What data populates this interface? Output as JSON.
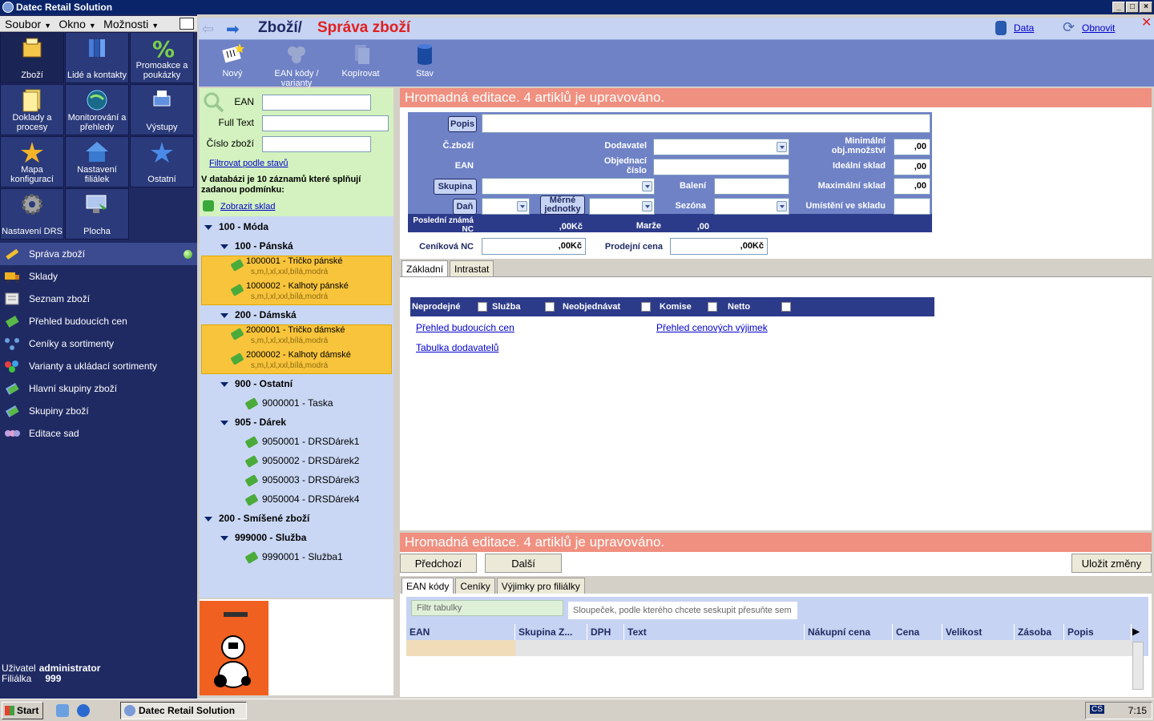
{
  "window": {
    "title": "Datec Retail Solution"
  },
  "menu": {
    "items": [
      "Soubor",
      "Okno",
      "Možnosti"
    ]
  },
  "tiles": [
    {
      "label": "Zboží",
      "icon": "box-icon"
    },
    {
      "label": "Lidé a kontakty",
      "icon": "books-icon"
    },
    {
      "label": "Promoakce a poukázky",
      "icon": "percent-icon"
    },
    {
      "label": "Doklady a procesy",
      "icon": "documents-icon"
    },
    {
      "label": "Monitorování a přehledy",
      "icon": "globe-icon"
    },
    {
      "label": "Výstupy",
      "icon": "printer-icon"
    },
    {
      "label": "Mapa konfigurací",
      "icon": "star-burst-icon"
    },
    {
      "label": "Nastavení filiálek",
      "icon": "house-icon"
    },
    {
      "label": "Ostatní",
      "icon": "star-icon"
    },
    {
      "label": "Nastavení DRS",
      "icon": "gear-icon"
    },
    {
      "label": "Plocha",
      "icon": "desktop-icon"
    }
  ],
  "nav": [
    {
      "label": "Správa zboží",
      "icon": "wrench-icon"
    },
    {
      "label": "Sklady",
      "icon": "truck-icon"
    },
    {
      "label": "Seznam zboží",
      "icon": "list-icon"
    },
    {
      "label": "Přehled budoucích cen",
      "icon": "pricetag-icon"
    },
    {
      "label": "Ceníky a sortimenty",
      "icon": "network-icon"
    },
    {
      "label": "Varianty a ukládací sortimenty",
      "icon": "balls-icon"
    },
    {
      "label": "Hlavní skupiny zboží",
      "icon": "tags-icon"
    },
    {
      "label": "Skupiny zboží",
      "icon": "tags-icon"
    },
    {
      "label": "Editace sad",
      "icon": "spheres-icon"
    }
  ],
  "user": {
    "label_user": "Uživatel",
    "user": "administrator",
    "label_branch": "Filiálka",
    "branch": "999"
  },
  "header": {
    "crumb": "Zboží/",
    "title": "Správa zboží",
    "data": "Data",
    "refresh": "Obnovit"
  },
  "toolbar": {
    "new": "Nový",
    "ean": "EAN kódy / varianty",
    "copy": "Kopírovat",
    "state": "Stav"
  },
  "search": {
    "ean": "EAN",
    "fulltext": "Full Text",
    "number": "Číslo zboží",
    "filter_link": "Filtrovat podle stavů",
    "result": "V databázi je 10 záznamů které splňují zadanou podmínku:",
    "show_stock": "Zobrazit sklad"
  },
  "tree": {
    "g1": "100 - Móda",
    "g1a": "100 - Pánská",
    "i1": "1000001 - Tričko pánské",
    "i1s": "s,m,l,xl,xxl,bílá,modrá",
    "i2": "1000002 - Kalhoty pánské",
    "i2s": "s,m,l,xl,xxl,bílá,modrá",
    "g1b": "200 - Dámská",
    "i3": "2000001 - Tričko dámské",
    "i3s": "s,m,l,xl,xxl,bílá,modrá",
    "i4": "2000002 - Kalhoty dámské",
    "i4s": "s,m,l,xl,xxl,bílá,modrá",
    "g2": "900 - Ostatní",
    "i5": "9000001 - Taska",
    "g3": "905 - Dárek",
    "i6": "9050001 - DRSDárek1",
    "i7": "9050002 - DRSDárek2",
    "i8": "9050003 - DRSDárek3",
    "i9": "9050004 - DRSDárek4",
    "g4": "200 - Smíšené zboží",
    "g4a": "999000 - Služba",
    "i10": "9990001 - Služba1"
  },
  "edit": {
    "banner": "Hromadná editace. 4 artiklů je upravováno.",
    "popis": "Popis",
    "czbozi": "Č.zboží",
    "dodavatel": "Dodavatel",
    "min": "Minimální obj.množství",
    "min_v": ",00",
    "ean": "EAN",
    "objednaci": "Objednací číslo",
    "ideal": "Ideální sklad",
    "ideal_v": ",00",
    "skupina": "Skupina",
    "baleni": "Balení",
    "max": "Maximální sklad",
    "max_v": ",00",
    "dan": "Daň",
    "merne": "Měrné jednotky",
    "sezona": "Sezóna",
    "umisteni": "Umístění ve skladu",
    "posledni": "Poslední známá NC",
    "posledni_v": ",00Kč",
    "marze": "Marže",
    "marze_v": ",00",
    "cenikova": "Ceníková NC",
    "cenikova_v": ",00Kč",
    "prodejni": "Prodejní cena",
    "prodejni_v": ",00Kč",
    "tab1": "Základní",
    "tab2": "Intrastat",
    "chk": [
      "Neprodejné",
      "Služba",
      "Neobjednávat",
      "Komise",
      "Netto"
    ],
    "link1": "Přehled budoucích cen",
    "link2": "Přehled cenových výjimek",
    "link3": "Tabulka dodavatelů"
  },
  "bottom": {
    "banner": "Hromadná editace. 4 artiklů je upravováno.",
    "prev": "Předchozí",
    "next": "Další",
    "save": "Uložit změny",
    "tabs": [
      "EAN kódy",
      "Ceníky",
      "Výjimky pro filiálky"
    ],
    "filter": "Filtr tabulky",
    "group": "Sloupeček, podle kterého chcete seskupit přesuňte sem",
    "cols": [
      "EAN",
      "Skupina Z...",
      "DPH",
      "Text",
      "Nákupní cena",
      "Cena",
      "Velikost",
      "Zásoba",
      "Popis"
    ]
  },
  "taskbar": {
    "start": "Start",
    "app": "Datec Retail Solution",
    "lang": "CS",
    "time": "7:15"
  },
  "colors": {
    "accent": "#0a246a",
    "sidebar": "#1f2a63",
    "salmon": "#f09080",
    "highlight": "#f8c43c"
  }
}
